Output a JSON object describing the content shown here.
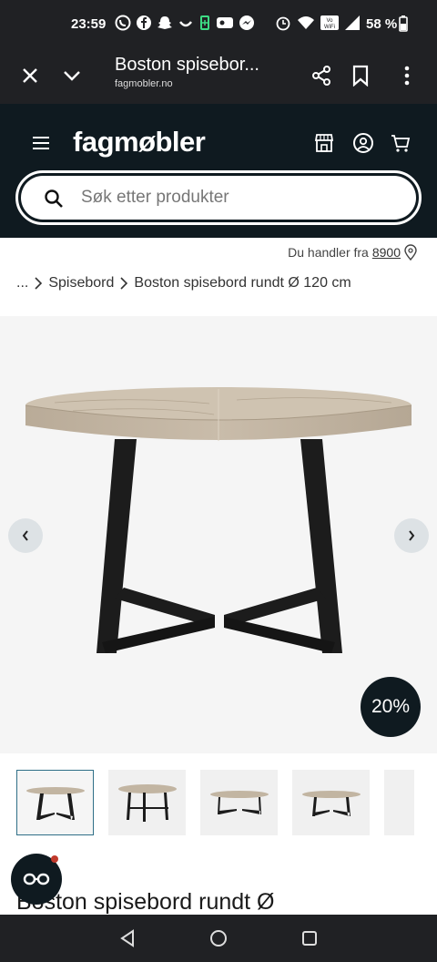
{
  "status_bar": {
    "time": "23:59",
    "battery": "58 %",
    "icons_left": [
      "whatsapp-icon",
      "facebook-icon",
      "snapchat-icon",
      "smile-icon",
      "battery-saver-icon",
      "vpn-icon",
      "messenger-icon"
    ],
    "icons_right": [
      "alarm-icon",
      "wifi-icon",
      "volte-icon",
      "signal-icon",
      "battery-icon"
    ]
  },
  "browser": {
    "page_title": "Boston spisebor...",
    "url": "fagmobler.no"
  },
  "header": {
    "logo": "fagmøbler",
    "search_placeholder": "Søk etter produkter"
  },
  "location": {
    "label": "Du handler fra",
    "postcode": "8900"
  },
  "breadcrumb": {
    "ellipsis": "...",
    "items": [
      "Spisebord",
      "Boston spisebord rundt Ø 120 cm"
    ]
  },
  "gallery": {
    "discount_badge": "20%",
    "prev_icon": "‹",
    "next_icon": "›"
  },
  "product": {
    "title": "Boston spisebord rundt Ø"
  },
  "colors": {
    "header_bg": "#0f1a20",
    "system_bar_bg": "#202124",
    "gallery_bg": "#f5f5f5",
    "accent_border": "#2f6f87"
  }
}
